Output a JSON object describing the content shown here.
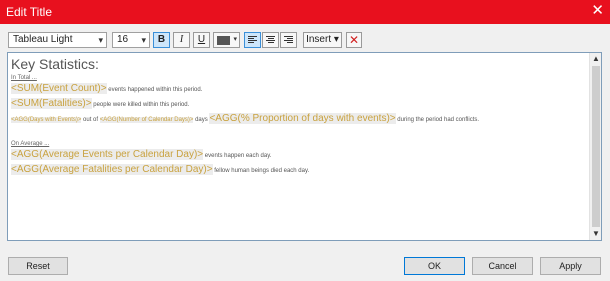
{
  "window": {
    "title": "Edit Title",
    "close_glyph": "✕"
  },
  "toolbar": {
    "font": "Tableau Light",
    "size": "16",
    "bold": "B",
    "italic": "I",
    "underline": "U",
    "insert": "Insert ▾",
    "clear_glyph": "✕",
    "font_color": "#555555"
  },
  "editor": {
    "heading": "Key Statistics:",
    "in_total_label": "In Total ...",
    "line1": {
      "field": "<SUM(Event Count)>",
      "text": " events happened within this period."
    },
    "line2": {
      "field": "<SUM(Fatalities)>",
      "text": " people were killed within this period."
    },
    "line3": {
      "field1": "<AGG(Days with Events)>",
      "text1": " out of ",
      "field2": "<AGG(Number of Calendar Days)>",
      "text2": " days ",
      "field3": "<AGG(% Proportion of days with events)>",
      "text3": " during the period had conflicts."
    },
    "on_average_label": "On Average ...",
    "line4": {
      "field": "<AGG(Average Events per Calendar Day)>",
      "text": " events happen each day."
    },
    "line5": {
      "field": "<AGG(Average Fatalities per Calendar Day)>",
      "text": " fellow human beings died each day."
    },
    "field_color": "#c9a23f"
  },
  "footer": {
    "reset": "Reset",
    "ok": "OK",
    "cancel": "Cancel",
    "apply": "Apply"
  },
  "colors": {
    "titlebar": "#e8101e",
    "active_toggle": "#cde6fb"
  }
}
